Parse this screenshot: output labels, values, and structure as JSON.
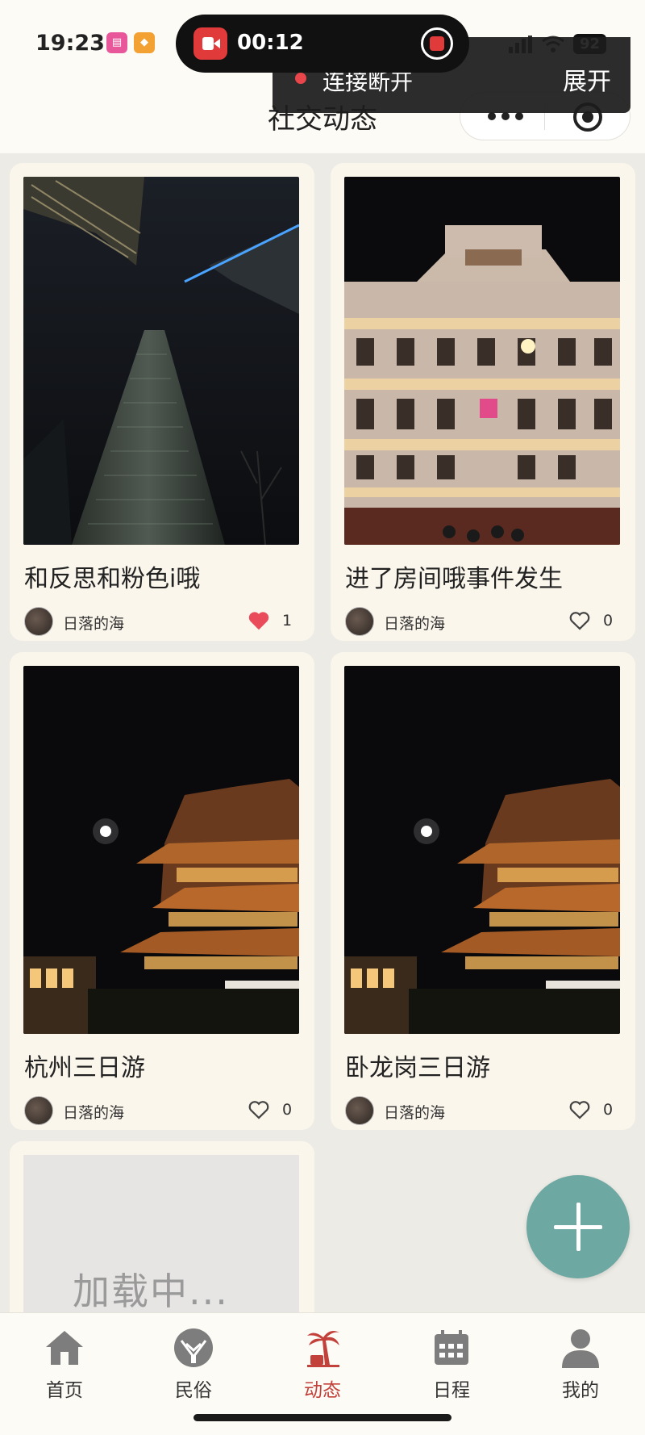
{
  "status_bar": {
    "time": "19:23",
    "battery": "92"
  },
  "recording": {
    "elapsed": "00:12"
  },
  "disconnect_banner": {
    "text": "连接断开",
    "expand_label": "展开"
  },
  "page": {
    "title": "社交动态"
  },
  "feed": {
    "posts": [
      {
        "title": "和反思和粉色i哦",
        "author": "日落的海",
        "likes": "1",
        "liked": true,
        "image": "skyscraper-night"
      },
      {
        "title": "进了房间哦事件发生",
        "author": "日落的海",
        "likes": "0",
        "liked": false,
        "image": "european-building-night"
      },
      {
        "title": "杭州三日游",
        "author": "日落的海",
        "likes": "0",
        "liked": false,
        "image": "pagoda-moon-night"
      },
      {
        "title": "卧龙岗三日游",
        "author": "日落的海",
        "likes": "0",
        "liked": false,
        "image": "pagoda-moon-night"
      }
    ],
    "loading_text": "加载中..."
  },
  "fab": {
    "icon": "plus-icon"
  },
  "tabbar": {
    "items": [
      {
        "label": "首页",
        "icon": "home-icon"
      },
      {
        "label": "民俗",
        "icon": "folk-icon"
      },
      {
        "label": "动态",
        "icon": "palm-tree-icon",
        "active": true
      },
      {
        "label": "日程",
        "icon": "calendar-icon"
      },
      {
        "label": "我的",
        "icon": "user-icon"
      }
    ]
  },
  "colors": {
    "accent": "#c2413a",
    "fab": "#6ea8a3",
    "card_bg": "#fbf6ec",
    "page_bg": "#ecebe5",
    "like_red": "#e94b5b"
  }
}
